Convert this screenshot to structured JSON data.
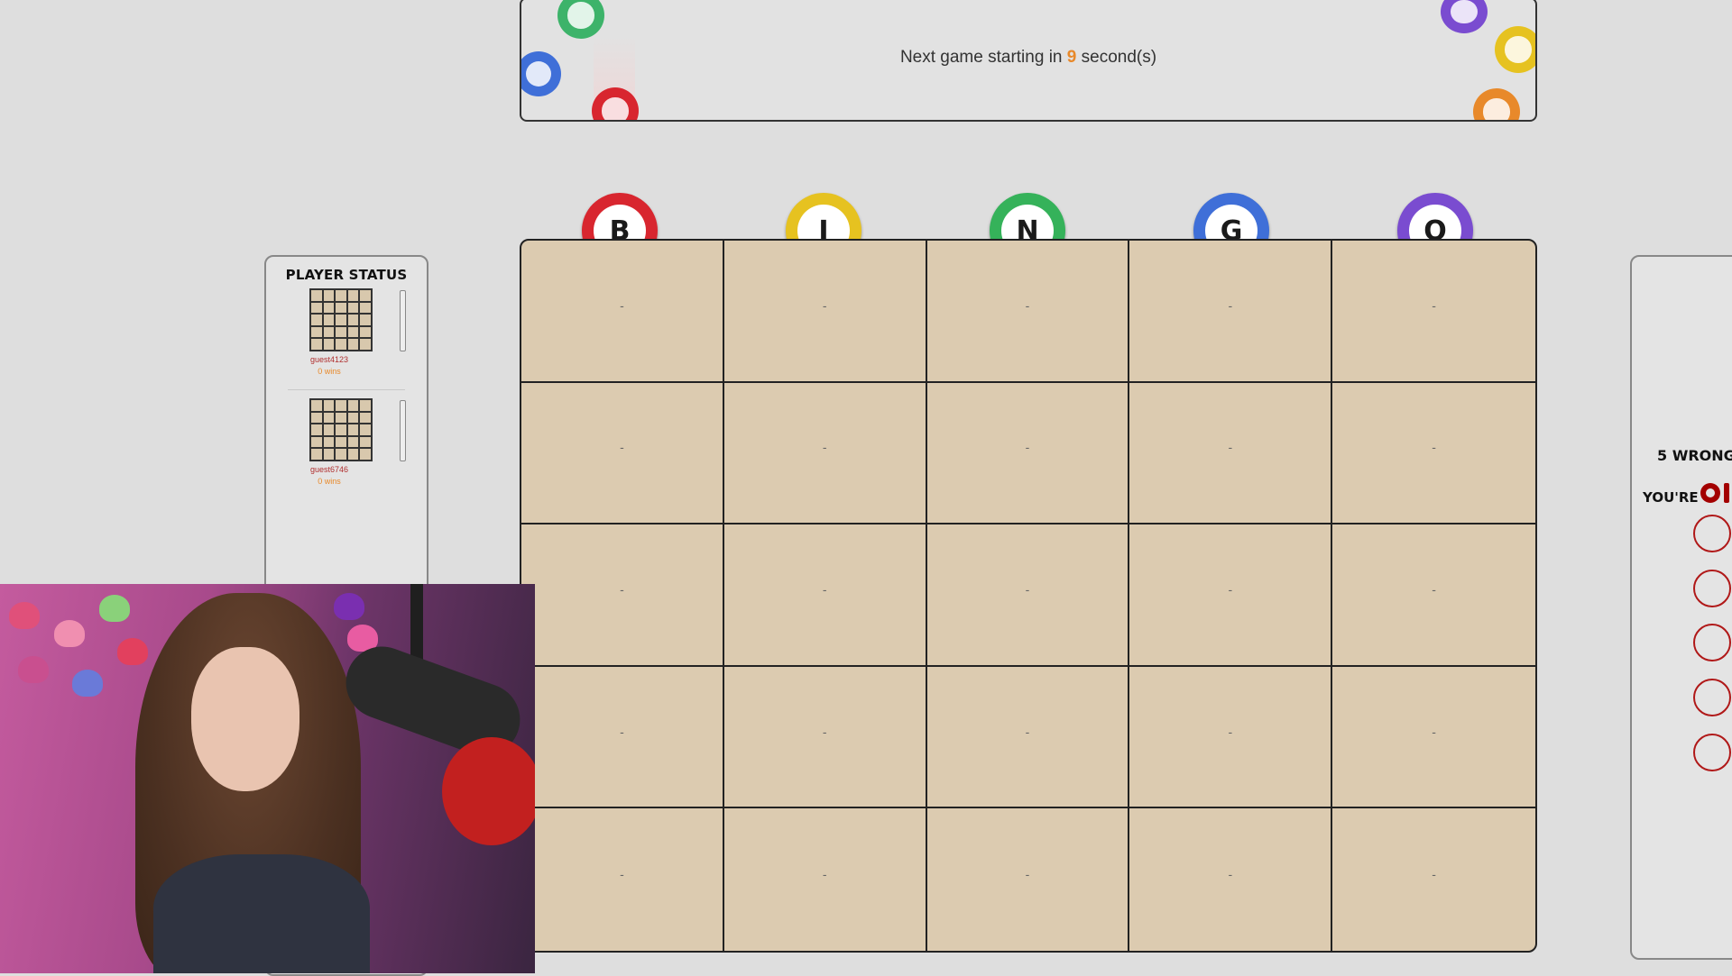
{
  "banner": {
    "prefix": "Next game starting in ",
    "countdown": "9",
    "suffix": " second(s)"
  },
  "bingo_header": {
    "letters": [
      "B",
      "I",
      "N",
      "G",
      "O"
    ],
    "colors": [
      "#d8262f",
      "#e6c220",
      "#35b25a",
      "#3f6fd8",
      "#7a4cd0"
    ]
  },
  "board": {
    "cells": [
      [
        "-",
        "-",
        "-",
        "-",
        "-"
      ],
      [
        "-",
        "-",
        "-",
        "-",
        "-"
      ],
      [
        "-",
        "-",
        "-",
        "-",
        "-"
      ],
      [
        "-",
        "-",
        "-",
        "-",
        "-"
      ],
      [
        "-",
        "-",
        "-",
        "-",
        "-"
      ]
    ]
  },
  "player_status": {
    "title": "PLAYER STATUS",
    "players": [
      {
        "name": "guest4123",
        "wins": "0 wins"
      },
      {
        "name": "guest6746",
        "wins": "0 wins"
      }
    ]
  },
  "right_panel": {
    "wrong_text": "5 WRONG",
    "youre_text": "YOU'RE",
    "strike_count": 5
  },
  "colors": {
    "background": "#dedede",
    "board_fill": "#dccbb0",
    "accent_orange": "#e8892a",
    "strike_red": "#b01818"
  }
}
